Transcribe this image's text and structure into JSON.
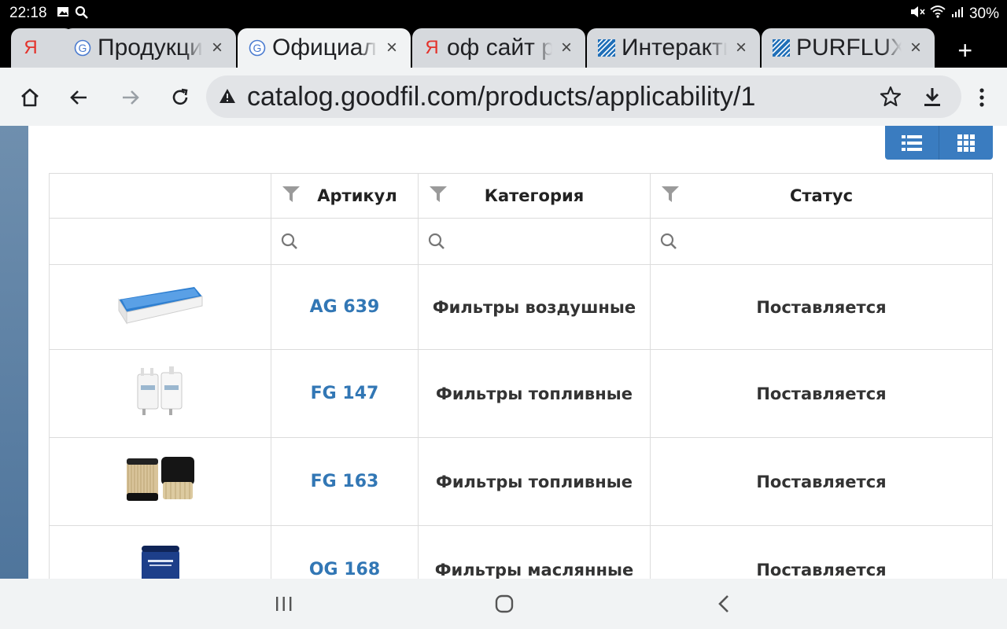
{
  "status_bar": {
    "time": "22:18",
    "battery": "30%"
  },
  "tabs": [
    {
      "label": "Я",
      "favicon": "yandex",
      "active": false
    },
    {
      "label": "Продукция",
      "favicon": "google",
      "active": false
    },
    {
      "label": "Официальный",
      "favicon": "google",
      "active": true
    },
    {
      "label": "оф сайт р",
      "favicon": "yandex",
      "active": false
    },
    {
      "label": "Интерактивный",
      "favicon": "purflux",
      "active": false
    },
    {
      "label": "PURFLUX",
      "favicon": "purflux",
      "active": false
    }
  ],
  "tab_close_glyph": "×",
  "new_tab_glyph": "+",
  "address_bar": {
    "url": "catalog.goodfil.com/products/applicability/1"
  },
  "table": {
    "columns": [
      "Артикул",
      "Категория",
      "Статус"
    ],
    "rows": [
      {
        "image": "air-filter",
        "article": "AG 639",
        "category": "Фильтры воздушные",
        "status": "Поставляется"
      },
      {
        "image": "fuel-filter-white",
        "article": "FG 147",
        "category": "Фильтры топливные",
        "status": "Поставляется"
      },
      {
        "image": "fuel-filter-cartridge",
        "article": "FG 163",
        "category": "Фильтры топливные",
        "status": "Поставляется"
      },
      {
        "image": "oil-filter",
        "article": "OG 168",
        "category": "Фильтры маслянные",
        "status": "Поставляется"
      }
    ]
  },
  "colors": {
    "link": "#3277b5",
    "view_toggle": "#3a7cc0",
    "sidebar": "#5a7fa3"
  }
}
